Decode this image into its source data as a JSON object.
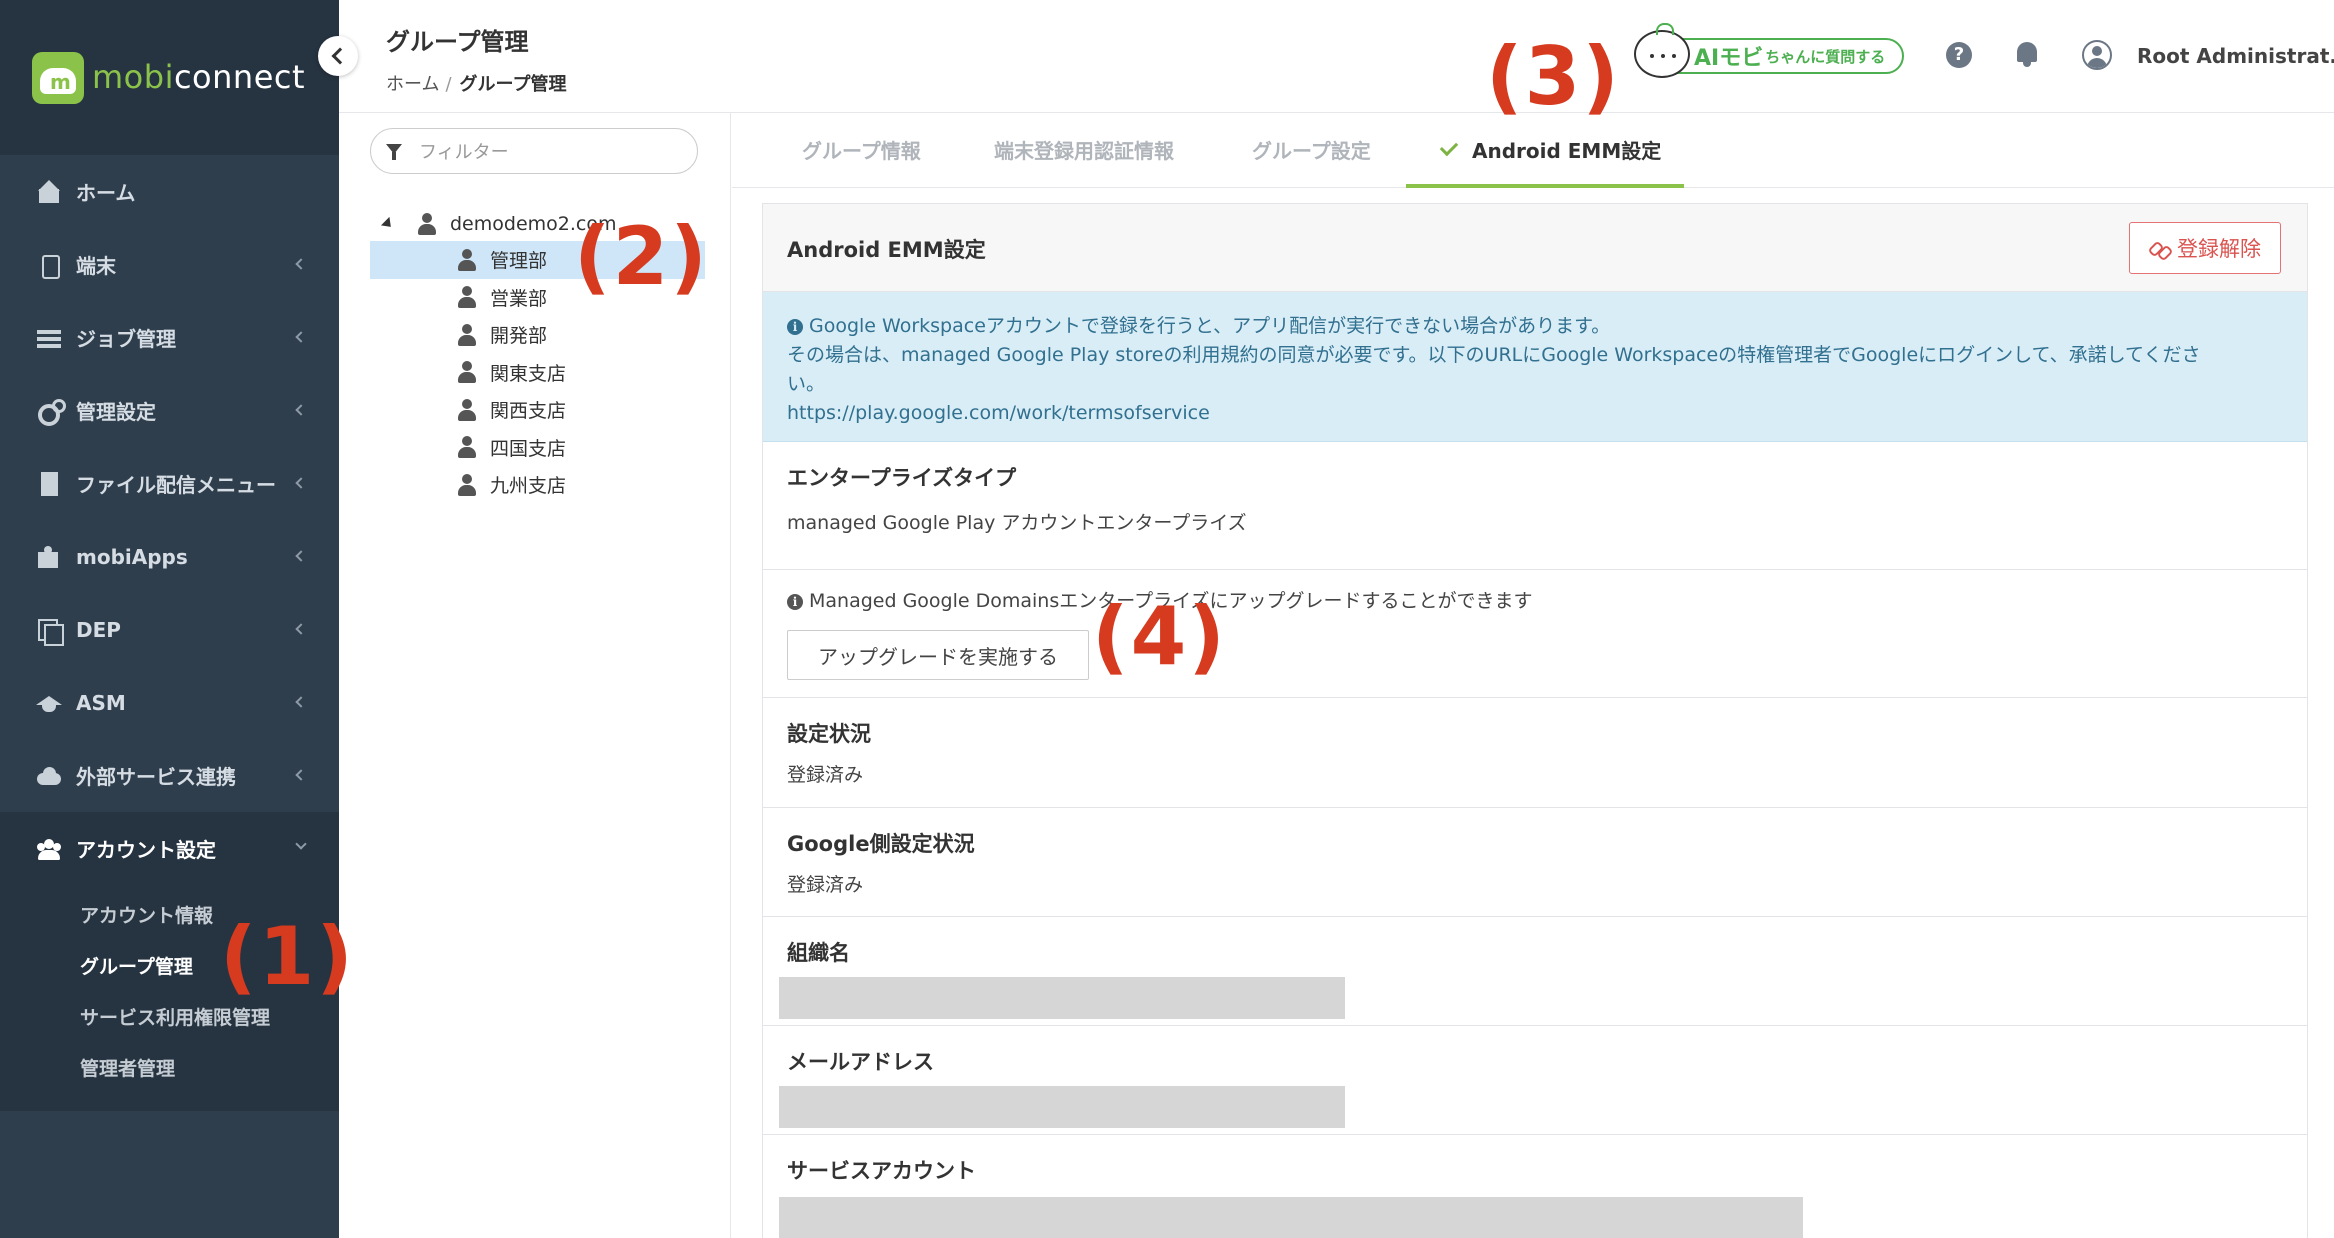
{
  "app": {
    "logo_prefix": "mobi",
    "logo_suffix": "connect"
  },
  "sidebar": {
    "items": [
      {
        "label": "ホーム",
        "icon": "home-icon"
      },
      {
        "label": "端末",
        "icon": "device-icon"
      },
      {
        "label": "ジョブ管理",
        "icon": "job-icon"
      },
      {
        "label": "管理設定",
        "icon": "gear-icon"
      },
      {
        "label": "ファイル配信メニュー",
        "icon": "file-icon"
      },
      {
        "label": "mobiApps",
        "icon": "puzzle-icon"
      },
      {
        "label": "DEP",
        "icon": "dep-icon"
      },
      {
        "label": "ASM",
        "icon": "graduation-cap-icon"
      },
      {
        "label": "外部サービス連携",
        "icon": "cloud-icon"
      },
      {
        "label": "アカウント設定",
        "icon": "users-icon"
      }
    ],
    "subitems": [
      {
        "label": "アカウント情報"
      },
      {
        "label": "グループ管理"
      },
      {
        "label": "サービス利用権限管理"
      },
      {
        "label": "管理者管理"
      }
    ]
  },
  "header": {
    "title": "グループ管理",
    "breadcrumb": {
      "home": "ホーム",
      "sep": "/",
      "current": "グループ管理"
    },
    "ai_button": {
      "main": "AIモビ",
      "small": "ちゃんに質問する"
    },
    "user_name": "Root Administrat..."
  },
  "tree": {
    "filter_placeholder": "フィルター",
    "root": "demodemo2.com",
    "children": [
      "管理部",
      "営業部",
      "開発部",
      "関東支店",
      "関西支店",
      "四国支店",
      "九州支店"
    ]
  },
  "tabs": [
    {
      "label": "グループ情報"
    },
    {
      "label": "端末登録用認証情報"
    },
    {
      "label": "グループ設定"
    },
    {
      "label": "Android EMM設定"
    }
  ],
  "card": {
    "title": "Android EMM設定",
    "unregister_button": "登録解除",
    "alert": {
      "line1": "Google Workspaceアカウントで登録を行うと、アプリ配信が実行できない場合があります。",
      "line2": "その場合は、managed Google Play storeの利用規約の同意が必要です。以下のURLにGoogle Workspaceの特権管理者でGoogleにログインして、承諾してくださ",
      "line3": "い。",
      "link": "https://play.google.com/work/termsofservice"
    },
    "enterprise_type": {
      "label": "エンタープライズタイプ",
      "value": "managed Google Play アカウントエンタープライズ"
    },
    "upgrade": {
      "note": "Managed Google Domainsエンタープライズにアップグレードすることができます",
      "button": "アップグレードを実施する"
    },
    "setting_status": {
      "label": "設定状況",
      "value": "登録済み"
    },
    "google_status": {
      "label": "Google側設定状況",
      "value": "登録済み"
    },
    "org_name": {
      "label": "組織名"
    },
    "email": {
      "label": "メールアドレス"
    },
    "service_account": {
      "label": "サービスアカウント"
    }
  },
  "annotations": [
    "(1)",
    "(2)",
    "(3)",
    "(4)"
  ]
}
